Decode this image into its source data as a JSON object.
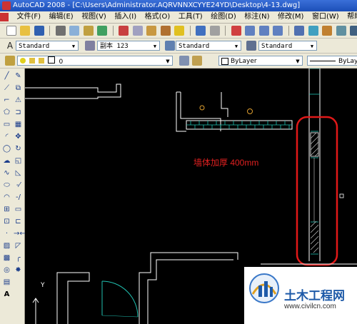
{
  "window": {
    "title": "AutoCAD 2008 - [C:\\Users\\Administrator.AQRVNNXCYYE24YD\\Desktop\\4-13.dwg]"
  },
  "menu": {
    "items": [
      "文件(F)",
      "编辑(E)",
      "视图(V)",
      "插入(I)",
      "格式(O)",
      "工具(T)",
      "绘图(D)",
      "标注(N)",
      "修改(M)",
      "窗口(W)",
      "帮助(H)"
    ],
    "window_controls": "_ ▫ ×"
  },
  "styles_toolbar": {
    "text_style": "Standard",
    "dim_style": "副本 123",
    "table_style": "Standard",
    "mleader_style": "Standard"
  },
  "layers_toolbar": {
    "current_layer": "0",
    "color": "ByLayer",
    "linetype": "ByLay"
  },
  "drawing": {
    "annotation": "墙体加厚 400mm",
    "ucs_y_label": "Y",
    "highlight_color": "#e01818",
    "wall_color": "#ffffff",
    "hatch_color": "#20c0b0"
  },
  "watermark": {
    "brand": "土木工程网",
    "url": "www.civilcn.com"
  }
}
